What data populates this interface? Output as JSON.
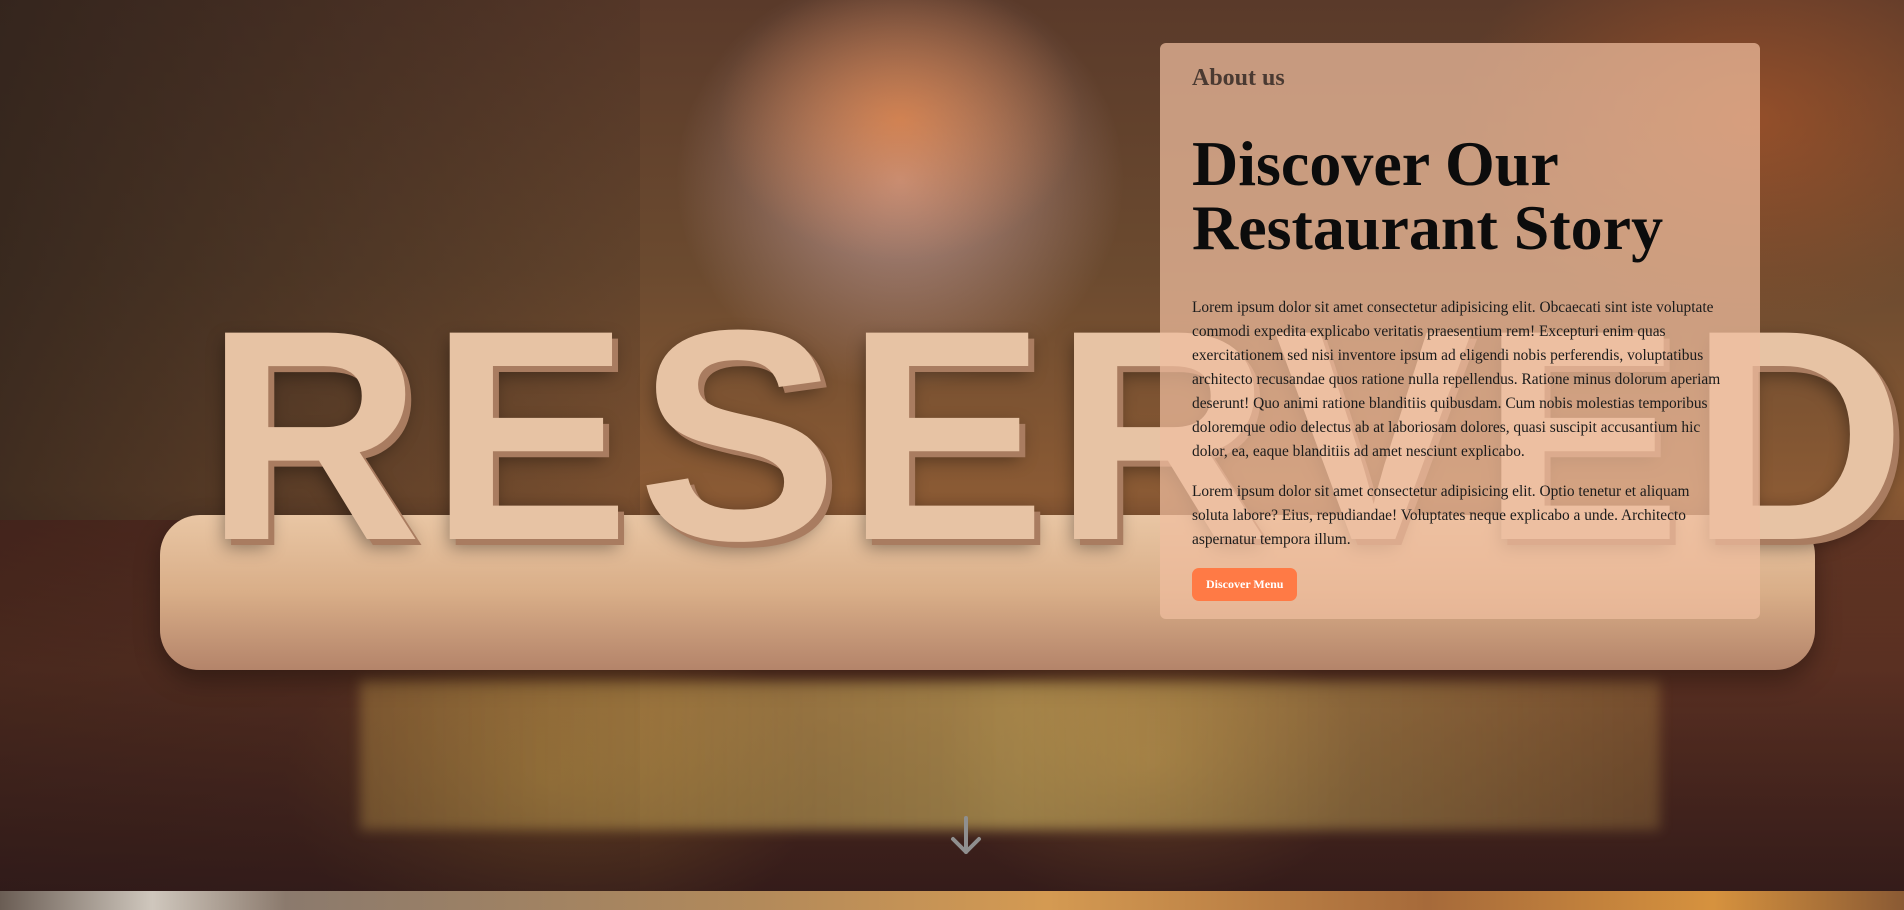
{
  "background": {
    "sign_text": "RESERVED"
  },
  "about": {
    "eyebrow": "About us",
    "title": "Discover Our Restaurant Story",
    "paragraph1": "Lorem ipsum dolor sit amet consectetur adipisicing elit. Obcaecati sint iste voluptate commodi expedita explicabo veritatis praesentium rem! Excepturi enim quas exercitationem sed nisi inventore ipsum ad eligendi nobis perferendis, voluptatibus architecto recusandae quos ratione nulla repellendus. Ratione minus dolorum aperiam deserunt! Quo animi ratione blanditiis quibusdam. Cum nobis molestias temporibus doloremque odio delectus ab at laboriosam dolores, quasi suscipit accusantium hic dolor, ea, eaque blanditiis ad amet nesciunt explicabo.",
    "paragraph2": "Lorem ipsum dolor sit amet consectetur adipisicing elit. Optio tenetur et aliquam soluta labore? Eius, repudiandae! Voluptates neque explicabo a unde. Architecto aspernatur tempora illum.",
    "button_label": "Discover Menu"
  },
  "icons": {
    "scroll": "arrow-down-icon"
  },
  "colors": {
    "accent": "#ff7a45",
    "card_bg": "rgba(240,190,160,0.72)"
  }
}
